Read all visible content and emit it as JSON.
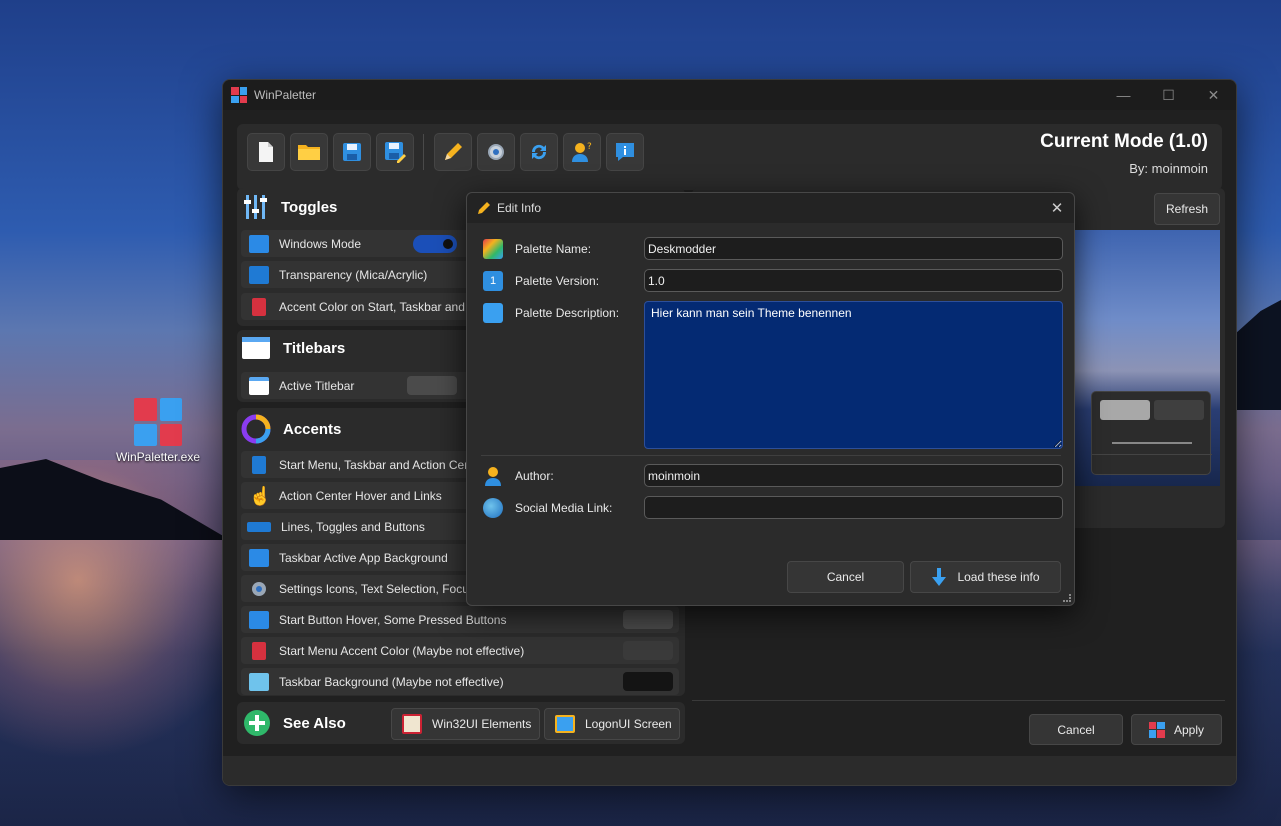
{
  "desktop": {
    "icon_label": "WinPaletter.exe"
  },
  "window": {
    "title": "WinPaletter",
    "mode_title": "Current Mode (1.0)",
    "mode_author": "By: moinmoin"
  },
  "toggles": {
    "title": "Toggles",
    "items": [
      {
        "label": "Windows Mode"
      },
      {
        "label": "Transparency (Mica/Acrylic)"
      },
      {
        "label": "Accent Color on Start, Taskbar and Action Center"
      }
    ]
  },
  "titlebars": {
    "title": "Titlebars",
    "items": [
      {
        "label": "Active Titlebar"
      }
    ]
  },
  "accents": {
    "title": "Accents",
    "items": [
      {
        "label": "Start Menu, Taskbar and Action Center"
      },
      {
        "label": "Action Center Hover and Links"
      },
      {
        "label": "Lines, Toggles and Buttons"
      },
      {
        "label": "Taskbar Active App Background"
      },
      {
        "label": "Settings Icons, Text Selection, Focus Dots"
      },
      {
        "label": "Start Button Hover, Some Pressed Buttons"
      },
      {
        "label": "Start Menu Accent Color (Maybe not effective)"
      },
      {
        "label": "Taskbar Background (Maybe not effective)"
      }
    ],
    "swatch_colors": [
      "#4b4b4b",
      "#3a3a3a",
      "#141414"
    ]
  },
  "see_also": {
    "title": "See Also",
    "win32ui": "Win32UI Elements",
    "logonui": "LogonUI Screen"
  },
  "preview": {
    "refresh": "Refresh"
  },
  "footer": {
    "cancel": "Cancel",
    "apply": "Apply"
  },
  "dialog": {
    "title": "Edit Info",
    "name_label": "Palette Name:",
    "name_value": "Deskmodder",
    "version_label": "Palette Version:",
    "version_value": "1.0",
    "description_label": "Palette Description:",
    "description_value": "Hier kann man sein Theme benennen",
    "author_label": "Author:",
    "author_value": "moinmoin",
    "social_label": "Social Media Link:",
    "social_value": "",
    "cancel": "Cancel",
    "load": "Load these info"
  },
  "colors": {
    "accent_blue": "#0078d4",
    "toggle_on": "#1b4fb8",
    "description_bg": "#042a73"
  }
}
